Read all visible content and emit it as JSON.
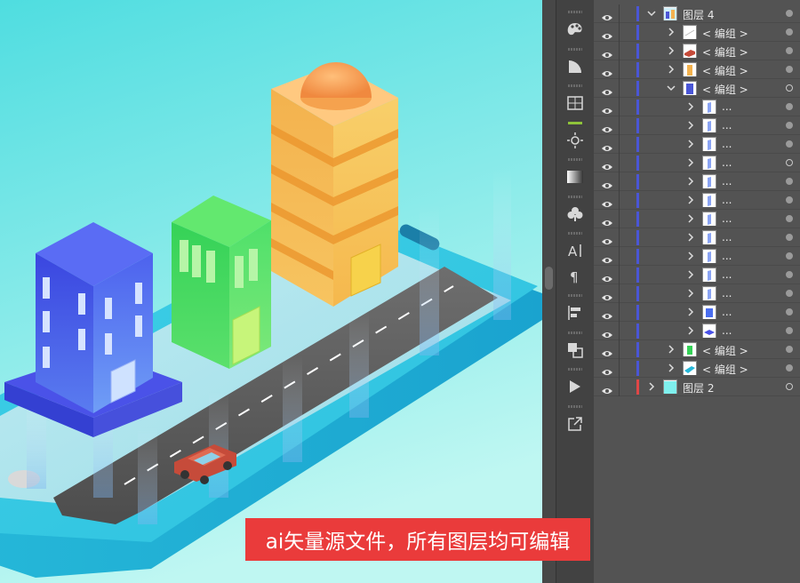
{
  "colors": {
    "canvas_bg_top": "#4fdde0",
    "canvas_bg_bottom": "#bff7f2",
    "banner_bg": "#ea3b3b",
    "layer_bar_blue": "#4a56d6",
    "layer_bar_red": "#e04646",
    "panel_bg": "#535353"
  },
  "banner": {
    "text": "ai矢量源文件，所有图层均可编辑"
  },
  "toolbar": {
    "icons": [
      "palette-icon",
      "gradient-icon",
      "artboards-icon",
      "brightness-icon",
      "gradient-swatch-icon",
      "club-symbol-icon",
      "character-icon",
      "paragraph-icon",
      "align-icon",
      "pathfinder-icon",
      "play-icon",
      "export-icon"
    ]
  },
  "layers": {
    "rows": [
      {
        "label": "图层 4",
        "indent": 0,
        "expanded": true,
        "thumb": "scene",
        "bar": "blue",
        "selected": true
      },
      {
        "label": "< 编组 >",
        "indent": 1,
        "expanded": false,
        "thumb": "white",
        "bar": "blue",
        "selected": true
      },
      {
        "label": "< 编组 >",
        "indent": 1,
        "expanded": false,
        "thumb": "car",
        "bar": "blue",
        "selected": true
      },
      {
        "label": "< 编组 >",
        "indent": 1,
        "expanded": false,
        "thumb": "orange",
        "bar": "blue",
        "selected": true
      },
      {
        "label": "< 编组 >",
        "indent": 1,
        "expanded": true,
        "thumb": "blue-building",
        "bar": "blue",
        "selected": false
      },
      {
        "label": "...",
        "indent": 2,
        "expanded": false,
        "thumb": "pane",
        "bar": "blue",
        "selected": true
      },
      {
        "label": "...",
        "indent": 2,
        "expanded": false,
        "thumb": "pane",
        "bar": "blue",
        "selected": true
      },
      {
        "label": "...",
        "indent": 2,
        "expanded": false,
        "thumb": "pane",
        "bar": "blue",
        "selected": true
      },
      {
        "label": "...",
        "indent": 2,
        "expanded": false,
        "thumb": "pane",
        "bar": "blue",
        "selected": false
      },
      {
        "label": "...",
        "indent": 2,
        "expanded": false,
        "thumb": "pane",
        "bar": "blue",
        "selected": true
      },
      {
        "label": "...",
        "indent": 2,
        "expanded": false,
        "thumb": "pane",
        "bar": "blue",
        "selected": true
      },
      {
        "label": "...",
        "indent": 2,
        "expanded": false,
        "thumb": "pane",
        "bar": "blue",
        "selected": true
      },
      {
        "label": "...",
        "indent": 2,
        "expanded": false,
        "thumb": "pane",
        "bar": "blue",
        "selected": true
      },
      {
        "label": "...",
        "indent": 2,
        "expanded": false,
        "thumb": "pane",
        "bar": "blue",
        "selected": true
      },
      {
        "label": "...",
        "indent": 2,
        "expanded": false,
        "thumb": "pane",
        "bar": "blue",
        "selected": true
      },
      {
        "label": "...",
        "indent": 2,
        "expanded": false,
        "thumb": "pane",
        "bar": "blue",
        "selected": true
      },
      {
        "label": "...",
        "indent": 2,
        "expanded": false,
        "thumb": "cube",
        "bar": "blue",
        "selected": true
      },
      {
        "label": "...",
        "indent": 2,
        "expanded": false,
        "thumb": "slab",
        "bar": "blue",
        "selected": true
      },
      {
        "label": "< 编组 >",
        "indent": 1,
        "expanded": false,
        "thumb": "green",
        "bar": "blue",
        "selected": true
      },
      {
        "label": "< 编组 >",
        "indent": 1,
        "expanded": false,
        "thumb": "phone",
        "bar": "blue",
        "selected": true
      },
      {
        "label": "图层 2",
        "indent": 0,
        "expanded": false,
        "thumb": "cyan",
        "bar": "red",
        "selected": false
      }
    ]
  }
}
